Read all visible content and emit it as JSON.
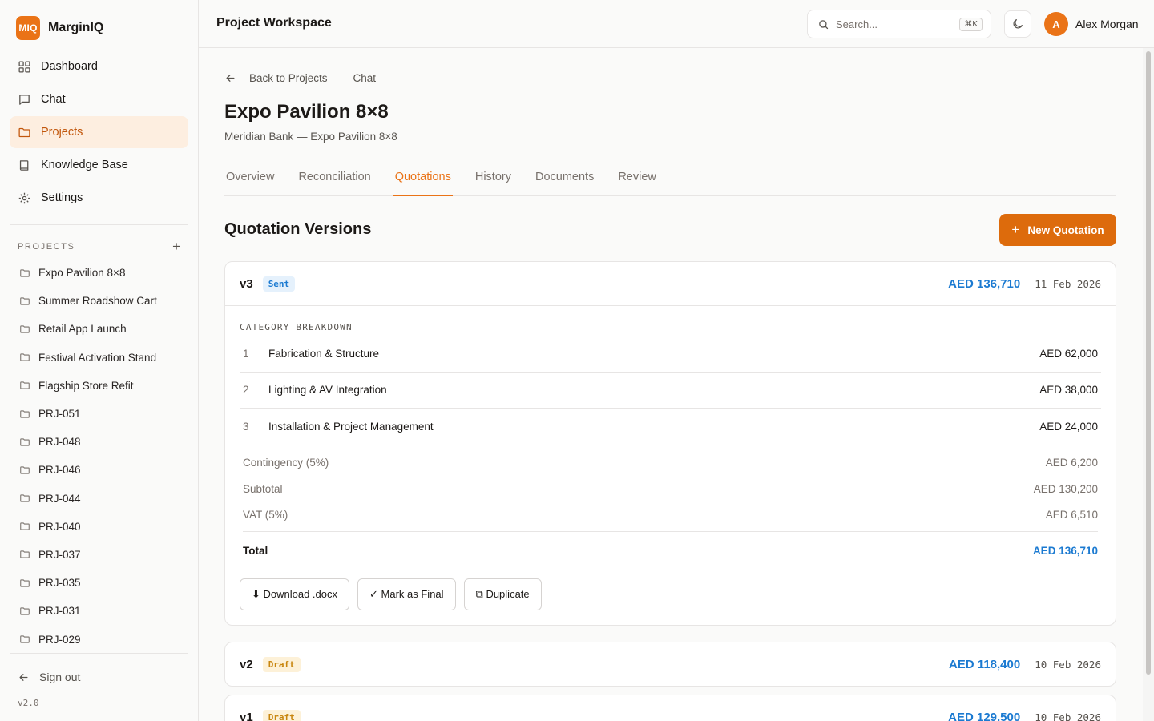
{
  "app": {
    "logo_text": "MIQ",
    "name": "MarginIQ",
    "brand_color": "#ea7317"
  },
  "nav": {
    "items": [
      {
        "label": "Dashboard",
        "icon": "grid-icon",
        "active": false
      },
      {
        "label": "Chat",
        "icon": "message-icon",
        "active": false
      },
      {
        "label": "Projects",
        "icon": "folder-icon",
        "active": true
      },
      {
        "label": "Knowledge Base",
        "icon": "book-icon",
        "active": false
      },
      {
        "label": "Settings",
        "icon": "gear-icon",
        "active": false
      }
    ]
  },
  "projects_section": {
    "heading": "PROJECTS",
    "add_label": "+",
    "items": [
      "Expo Pavilion 8×8",
      "Summer Roadshow Cart",
      "Retail App Launch",
      "Festival Activation Stand",
      "Flagship Store Refit",
      "PRJ-051",
      "PRJ-048",
      "PRJ-046",
      "PRJ-044",
      "PRJ-040",
      "PRJ-037",
      "PRJ-035",
      "PRJ-031",
      "PRJ-029"
    ]
  },
  "footer": {
    "signout_label": "Sign out",
    "version": "v2.0"
  },
  "topbar": {
    "title": "Project Workspace",
    "search_placeholder": "Search...",
    "search_shortcut": "⌘K",
    "user_initial": "A",
    "user_name": "Alex Morgan"
  },
  "breadcrumb": {
    "back_label": "Back to Projects",
    "current": "Chat"
  },
  "project": {
    "title": "Expo Pavilion 8×8",
    "subtitle": "Meridian Bank — Expo Pavilion 8×8"
  },
  "tabs": [
    {
      "label": "Overview",
      "active": false
    },
    {
      "label": "Reconciliation",
      "active": false
    },
    {
      "label": "Quotations",
      "active": true
    },
    {
      "label": "History",
      "active": false
    },
    {
      "label": "Documents",
      "active": false
    },
    {
      "label": "Review",
      "active": false
    }
  ],
  "quotations": {
    "heading": "Quotation Versions",
    "new_button_icon": "+",
    "new_button_label": "New Quotation",
    "breakdown_label": "CATEGORY BREAKDOWN",
    "versions": [
      {
        "version": "v3",
        "status": "Sent",
        "amount": "AED 136,710",
        "date": "11 Feb 2026",
        "expanded": true,
        "categories": [
          {
            "num": "1",
            "name": "Fabrication & Structure",
            "amount": "AED 62,000"
          },
          {
            "num": "2",
            "name": "Lighting & AV Integration",
            "amount": "AED 38,000"
          },
          {
            "num": "3",
            "name": "Installation & Project Management",
            "amount": "AED 24,000"
          }
        ],
        "summary": [
          {
            "label": "Contingency (5%)",
            "value": "AED 6,200"
          },
          {
            "label": "Subtotal",
            "value": "AED 130,200"
          },
          {
            "label": "VAT (5%)",
            "value": "AED 6,510"
          }
        ],
        "total_label": "Total",
        "total_value": "AED 136,710",
        "actions": [
          "⬇ Download .docx",
          "✓ Mark as Final",
          "⧉ Duplicate"
        ]
      },
      {
        "version": "v2",
        "status": "Draft",
        "amount": "AED 118,400",
        "date": "10 Feb 2026",
        "expanded": false
      },
      {
        "version": "v1",
        "status": "Draft",
        "amount": "AED 129,500",
        "date": "10 Feb 2026",
        "expanded": false
      }
    ]
  },
  "colors": {
    "accent": "#ea7317",
    "amount_blue": "#1b7ad1",
    "sent_badge_bg": "#e5f1fc",
    "draft_badge_bg": "#fdf1d8"
  }
}
